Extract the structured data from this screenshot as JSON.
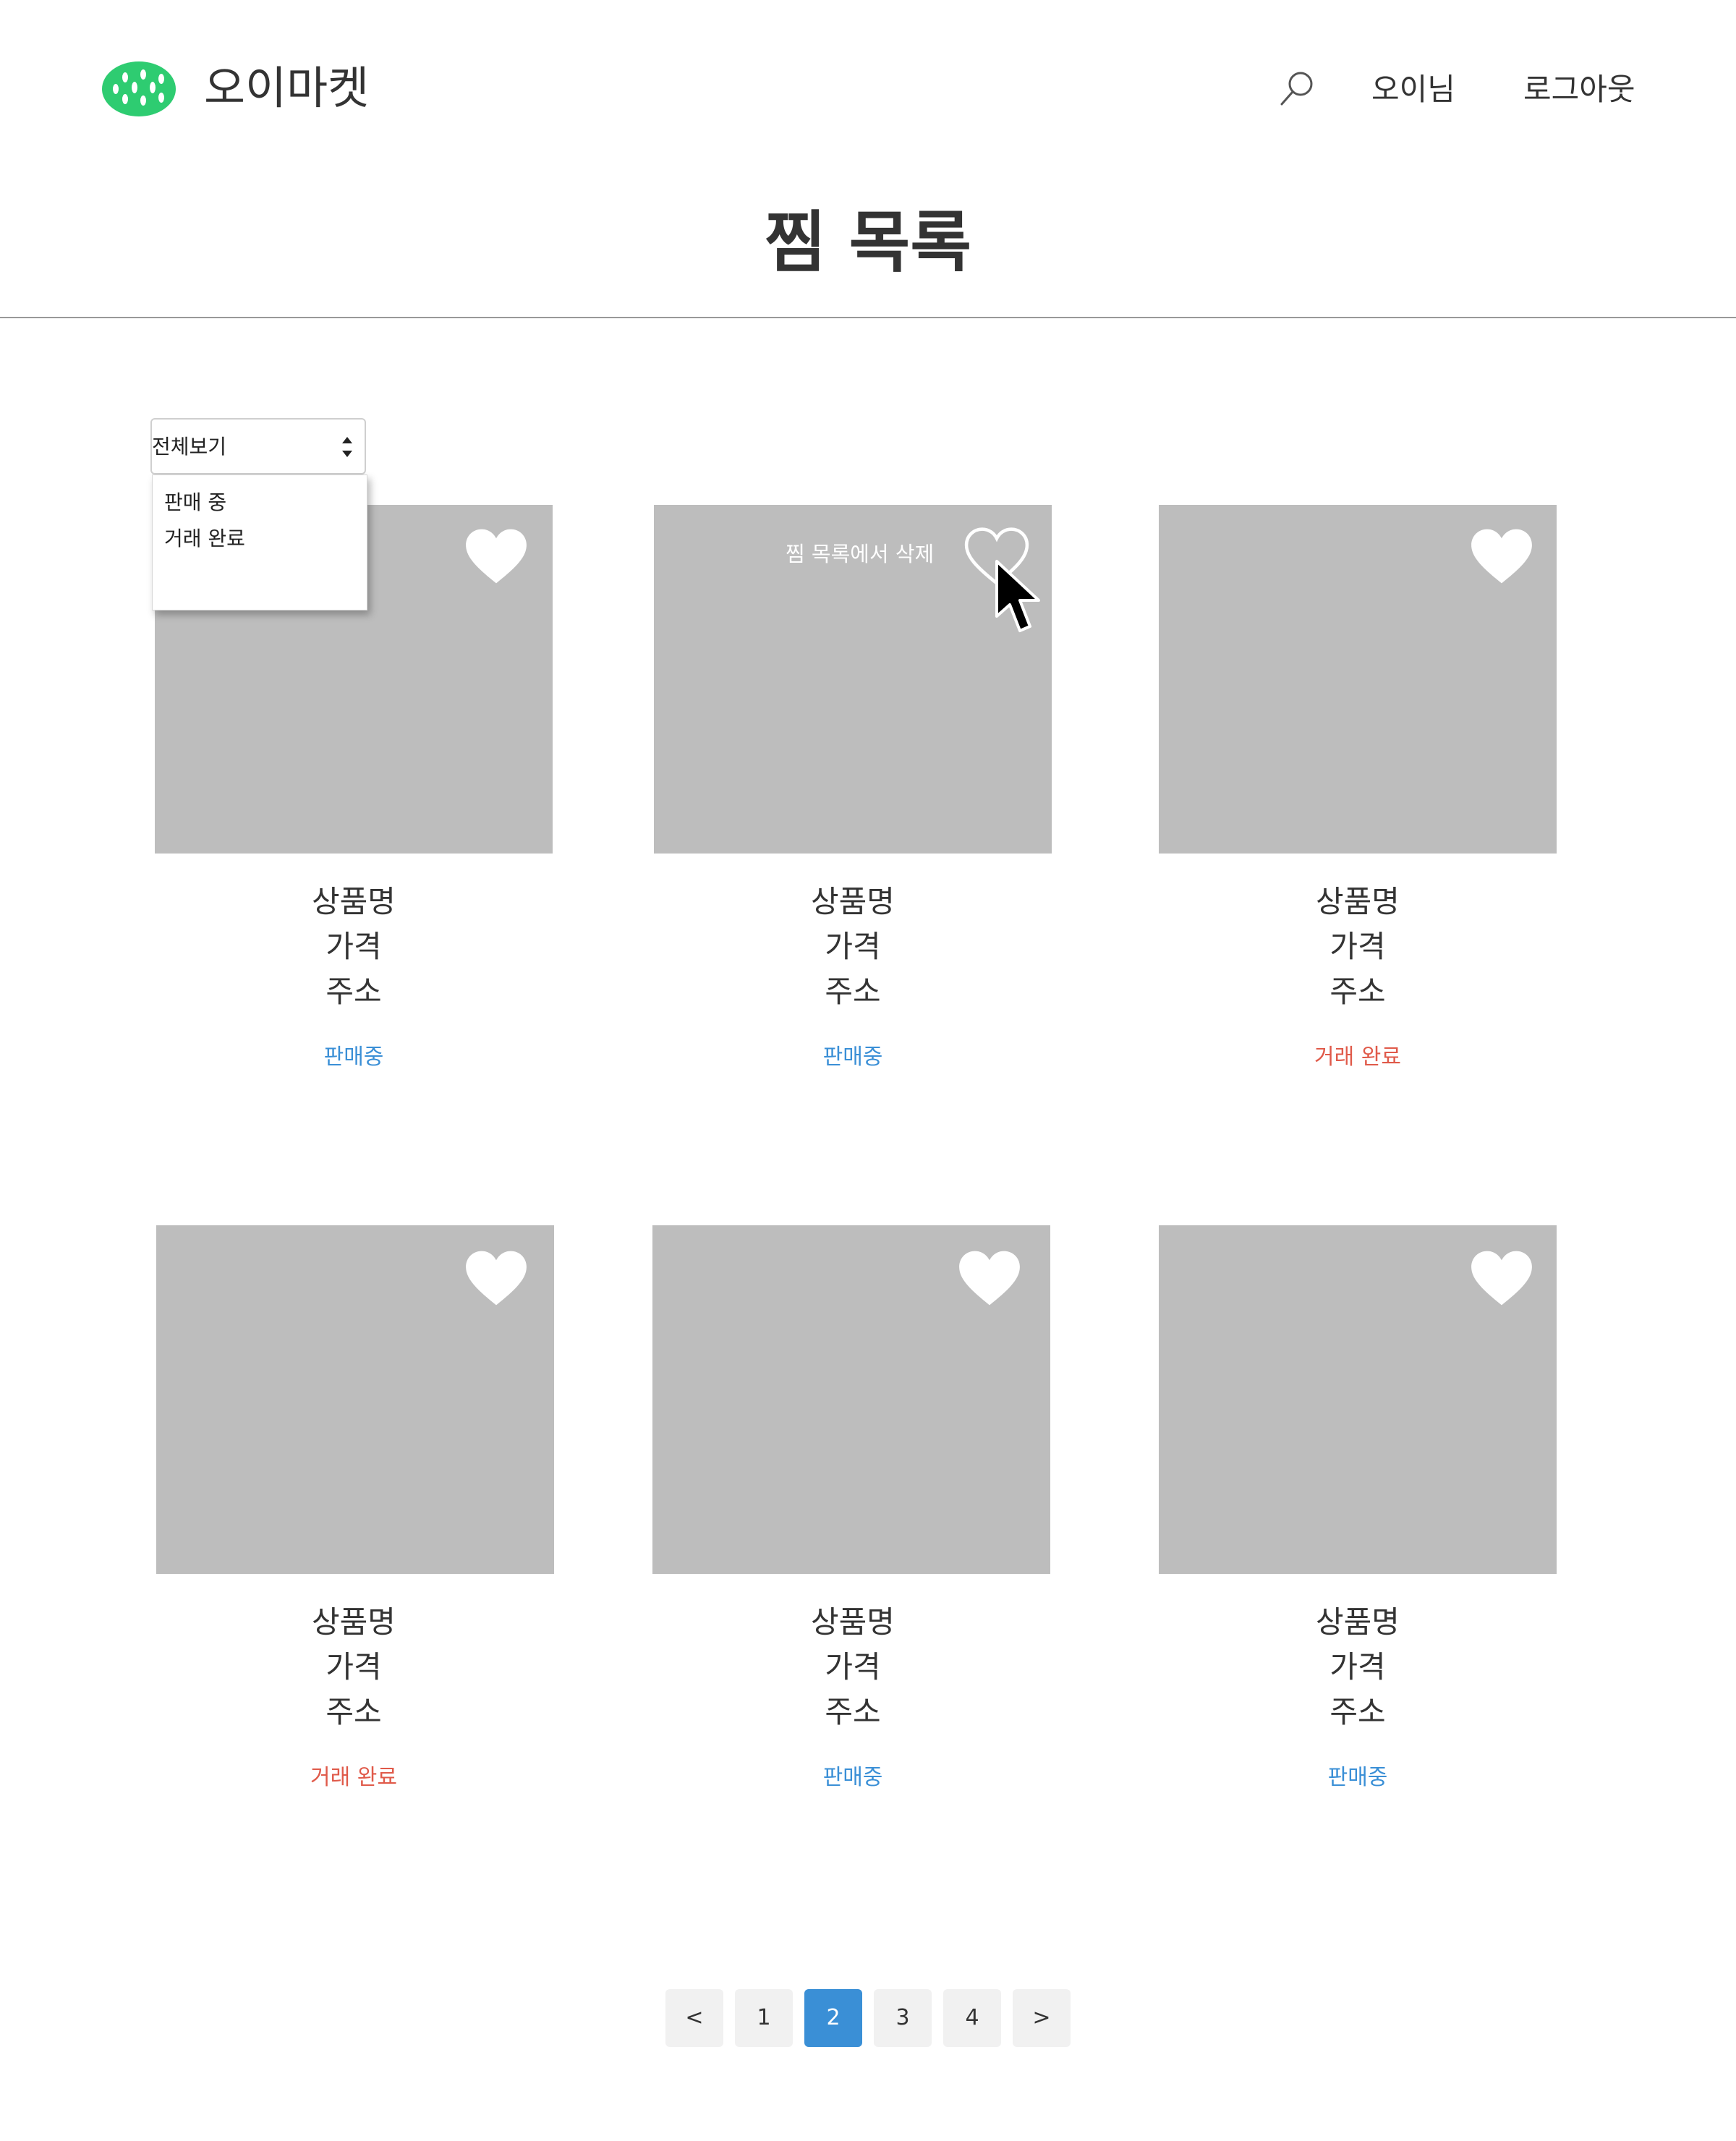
{
  "header": {
    "brand": "오이마켓",
    "user_label": "오이님",
    "logout_label": "로그아웃",
    "icons": {
      "logo": "cucumber-logo-icon",
      "search": "search-icon"
    }
  },
  "page_title": "찜 목록",
  "filter": {
    "selected": "전체보기",
    "options": [
      "판매 중",
      "거래 완료"
    ]
  },
  "tooltip": "찜 목록에서 삭제",
  "cards": [
    {
      "name": "상품명",
      "price": "가격",
      "address": "주소",
      "status": "판매중"
    },
    {
      "name": "상품명",
      "price": "가격",
      "address": "주소",
      "status": "판매중"
    },
    {
      "name": "상품명",
      "price": "가격",
      "address": "주소",
      "status": "거래 완료"
    },
    {
      "name": "상품명",
      "price": "가격",
      "address": "주소",
      "status": "거래 완료"
    },
    {
      "name": "상품명",
      "price": "가격",
      "address": "주소",
      "status": "판매중"
    },
    {
      "name": "상품명",
      "price": "가격",
      "address": "주소",
      "status": "판매중"
    }
  ],
  "pagination": {
    "prev": "<",
    "pages": [
      "1",
      "2",
      "3",
      "4"
    ],
    "current": "2",
    "next": ">"
  },
  "colors": {
    "brand_green": "#2ecc71",
    "status_selling": "#3a8fd6",
    "status_done": "#e05a4a",
    "placeholder_gray": "#bdbdbd",
    "page_active": "#3a8fd6"
  }
}
